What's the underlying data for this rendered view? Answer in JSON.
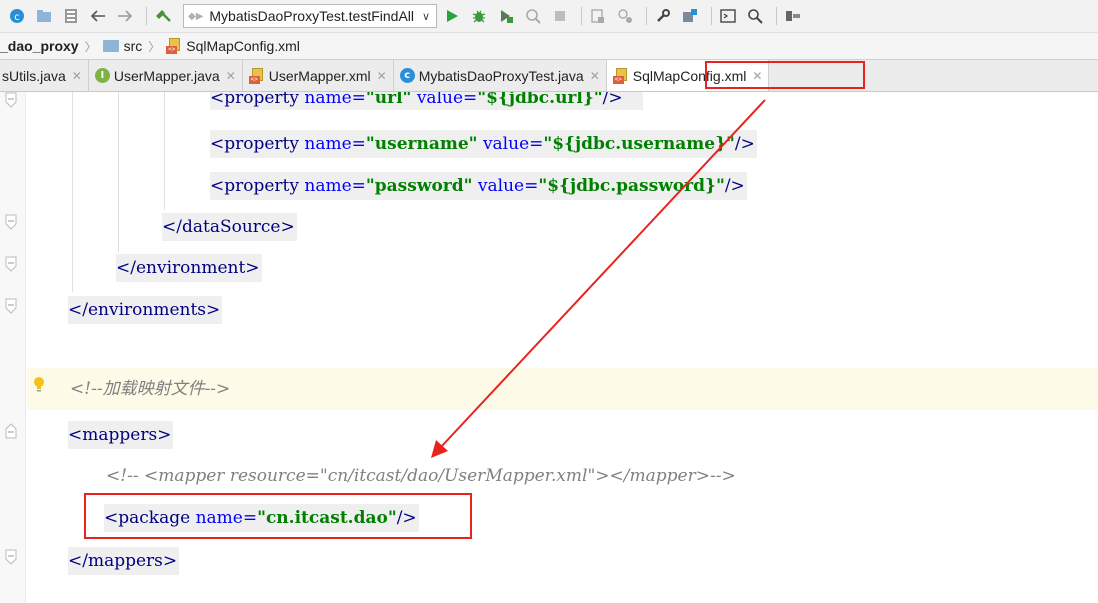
{
  "toolbar": {
    "run_config": "MybatisDaoProxyTest.testFindAll",
    "icons": [
      "project-structure-icon",
      "open-icon",
      "save-all-icon",
      "back-icon",
      "forward-icon",
      "build-icon",
      "run-icon",
      "debug-icon",
      "coverage-icon",
      "profile-icon",
      "stop-icon",
      "sdk-icon",
      "vcs-icon",
      "settings-icon",
      "project-settings-icon",
      "terminal-icon",
      "search-icon",
      "tools-icon"
    ]
  },
  "breadcrumb": {
    "project": "_dao_proxy",
    "folder": "src",
    "file": "SqlMapConfig.xml"
  },
  "tabs": [
    {
      "label": "sUtils.java",
      "icon": "none"
    },
    {
      "label": "UserMapper.java",
      "icon": "interface-icon"
    },
    {
      "label": "UserMapper.xml",
      "icon": "xml-icon"
    },
    {
      "label": "MybatisDaoProxyTest.java",
      "icon": "class-icon"
    },
    {
      "label": "SqlMapConfig.xml",
      "icon": "xml-icon",
      "active": true
    }
  ],
  "code": {
    "l1": {
      "open": "<property",
      "attr1": "name=",
      "val1": "\"url\"",
      "attr2": "value=",
      "val2": "\"${jdbc.url}\"",
      "close": "/>"
    },
    "l2": {
      "open": "<property",
      "attr1": "name=",
      "val1": "\"username\"",
      "attr2": "value=",
      "val2": "\"${jdbc.username}\"",
      "close": "/>"
    },
    "l3": {
      "open": "<property",
      "attr1": "name=",
      "val1": "\"password\"",
      "attr2": "value=",
      "val2": "\"${jdbc.password}\"",
      "close": "/>"
    },
    "l4": "</dataSource>",
    "l5": "</environment>",
    "l6": "</environments>",
    "l7": "<!--加载映射文件-->",
    "l8": "<mappers>",
    "l9": "<!-- <mapper resource=\"cn/itcast/dao/UserMapper.xml\"></mapper>-->",
    "l10": {
      "open": "<package",
      "attr1": "name=",
      "val1": "\"cn.itcast.dao\"",
      "close": "/>"
    },
    "l11": "</mappers>"
  },
  "colors": {
    "tag": "#000080",
    "attribute": "#0000ff",
    "value": "#008000",
    "comment": "#808080",
    "annotation_red": "#e8231e",
    "highlight_row": "#fdfae8"
  }
}
